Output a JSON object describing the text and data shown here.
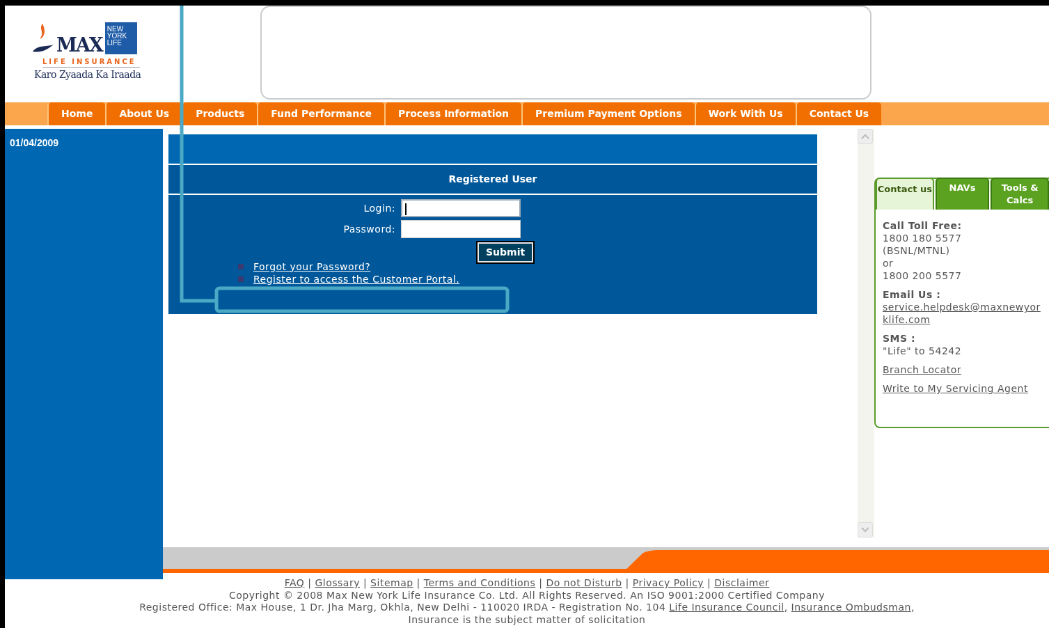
{
  "logo": {
    "brand": "MAX",
    "partner": "NEW YORK LIFE",
    "subtitle": "LIFE INSURANCE",
    "tagline": "Karo Zyaada Ka Iraada"
  },
  "nav": [
    {
      "label": "Home"
    },
    {
      "label": "About Us"
    },
    {
      "label": "Products"
    },
    {
      "label": "Fund Performance"
    },
    {
      "label": "Process Information"
    },
    {
      "label": "Premium Payment Options"
    },
    {
      "label": "Work With Us"
    },
    {
      "label": "Contact Us"
    }
  ],
  "sidebar": {
    "date": "01/04/2009"
  },
  "login": {
    "heading": "Registered User",
    "fields": [
      {
        "label": "Login:",
        "focused": true
      },
      {
        "label": "Password:",
        "focused": false
      }
    ],
    "submit": "Submit",
    "links": [
      "Forgot your Password?",
      "Register to access the Customer Portal."
    ]
  },
  "side_panel": {
    "tabs": [
      {
        "label": "Contact us",
        "selected": true
      },
      {
        "label": "NAVs",
        "selected": false
      },
      {
        "label": "Tools & Calcs",
        "selected": false
      }
    ],
    "blocks": [
      {
        "kind": "text",
        "heading": "Call Toll Free:",
        "lines": [
          "1800 180 5577",
          "(BSNL/MTNL)",
          "or",
          "1800 200 5577"
        ]
      },
      {
        "kind": "link",
        "heading": "Email Us :",
        "lines": [
          "service.helpdesk@maxnewyorklife.com"
        ]
      },
      {
        "kind": "text",
        "heading": "SMS :",
        "lines": [
          "\"Life\" to 54242"
        ]
      },
      {
        "kind": "link",
        "lines": [
          "Branch Locator"
        ]
      },
      {
        "kind": "link",
        "lines": [
          "Write to My Servicing Agent"
        ]
      }
    ]
  },
  "footer": {
    "separator": "|",
    "links": [
      "FAQ",
      "Glossary",
      "Sitemap",
      "Terms and Conditions",
      "Do not Disturb",
      "Privacy Policy",
      "Disclaimer"
    ],
    "copyright": "Copyright © 2008 Max New York Life Insurance Co. Ltd. All Rights Reserved. An ISO 9001:2000 Certified Company",
    "office": [
      {
        "kind": "text",
        "text": "Registered Office: Max House, 1 Dr. Jha Marg, Okhla, New Delhi - 110020 IRDA - Registration No. 104"
      },
      {
        "kind": "link",
        "text": "Life Insurance Council"
      },
      {
        "kind": "text",
        "text": ","
      },
      {
        "kind": "link",
        "text": "Insurance Ombudsman"
      },
      {
        "kind": "text",
        "text": ","
      }
    ],
    "notice": "Insurance is the subject matter of solicitation"
  }
}
